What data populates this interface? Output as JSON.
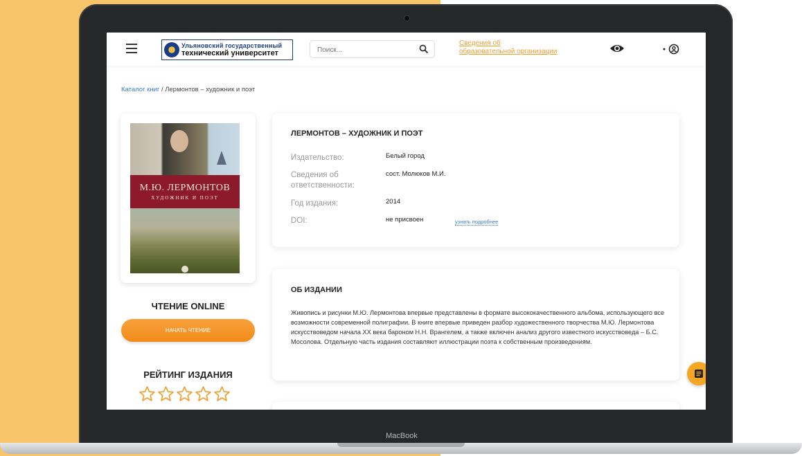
{
  "header": {
    "logo_line1": "Ульяновский государственный",
    "logo_line2": "технический университет",
    "search_placeholder": "Поиск...",
    "info_link_line1": "Сведения об",
    "info_link_line2": "образовательной организации"
  },
  "breadcrumb": {
    "catalog": "Каталог книг",
    "separator": "/",
    "current": "Лермонтов – художник и поэт"
  },
  "cover": {
    "title": "М.Ю. ЛЕРМОНТОВ",
    "subtitle": "ХУДОЖНИК И ПОЭТ"
  },
  "left": {
    "read_heading": "ЧТЕНИЕ ONLINE",
    "read_button": "НАЧАТЬ ЧТЕНИЕ",
    "rating_heading": "РЕЙТИНГ ИЗДАНИЯ",
    "rating_value": 0,
    "rating_max": 5
  },
  "details": {
    "title": "ЛЕРМОНТОВ – ХУДОЖНИК И ПОЭТ",
    "rows": [
      {
        "label": "Издательство:",
        "value": "Белый город"
      },
      {
        "label": "Сведения об ответственности:",
        "value": "сост. Молюков М.И."
      },
      {
        "label": "Год издания:",
        "value": "2014"
      },
      {
        "label": "DOI:",
        "value": "не присвоен"
      }
    ],
    "more_link": "узнать подробнее"
  },
  "about": {
    "title": "ОБ ИЗДАНИИ",
    "text": "Живопись и рисунки М.Ю. Лермонтова впервые представлены в формате высококачественного альбома, использующего все возможности современной полиграфии. В книге впервые приведен разбор художественного творчества М.Ю. Лермонтова искусствоведом начала XX века бароном Н.Н. Врангелем, а также включен анализ другого известного искусствоведа – Б.С. Мосолова. Отдельную часть издания составляют иллюстрации поэта к собственным произведениям."
  },
  "device": {
    "brand": "MacBook"
  },
  "icons": {
    "menu": "hamburger-icon",
    "search": "search-icon",
    "accessibility": "eye-icon",
    "user": "user-icon",
    "star": "star-outline-icon",
    "chat": "chat-icon"
  },
  "colors": {
    "accent": "#f29c2c",
    "link": "#3a7bd5",
    "background_left": "#f7c46a"
  }
}
